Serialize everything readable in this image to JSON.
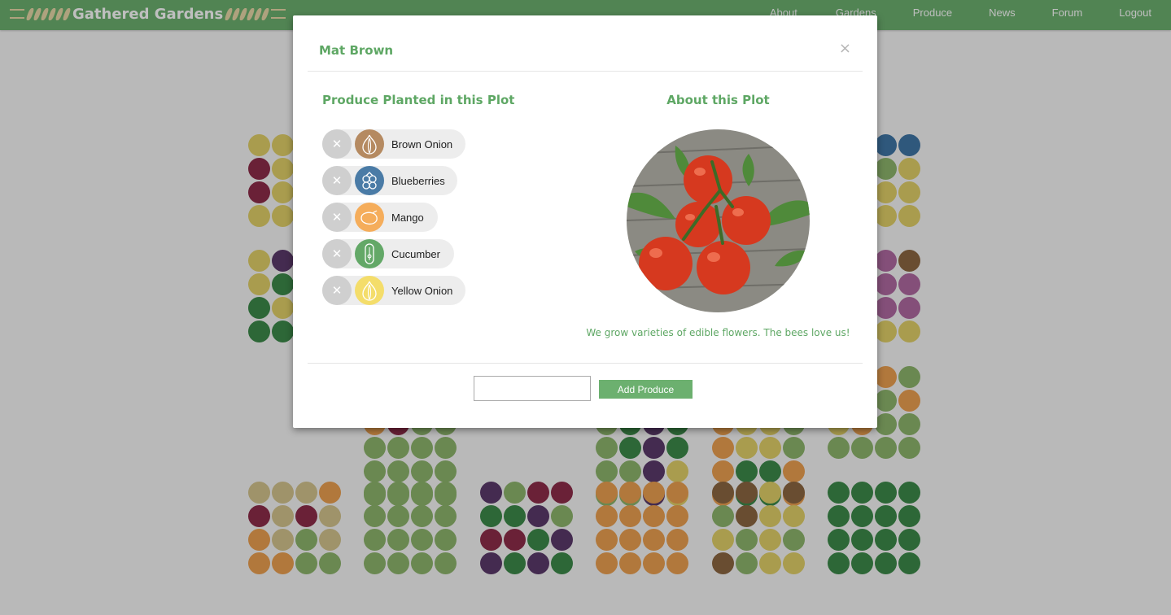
{
  "app": {
    "name": "Gathered Gardens"
  },
  "nav": {
    "about": "About",
    "gardens": "Gardens",
    "produce": "Produce",
    "news": "News",
    "forum": "Forum",
    "logout": "Logout"
  },
  "modal": {
    "title": "Mat Brown",
    "close": "×",
    "produce_heading": "Produce Planted in this Plot",
    "about_heading": "About this Plot",
    "about_text": "We grow varieties of edible flowers. The bees love us!",
    "remove_glyph": "✕",
    "produce": [
      {
        "name": "Brown Onion",
        "icon": "brown-onion-icon",
        "color": "#b58a61"
      },
      {
        "name": "Blueberries",
        "icon": "blueberries-icon",
        "color": "#4a7ba6"
      },
      {
        "name": "Mango",
        "icon": "mango-icon",
        "color": "#f5ad5b"
      },
      {
        "name": "Cucumber",
        "icon": "cucumber-icon",
        "color": "#63a867"
      },
      {
        "name": "Yellow Onion",
        "icon": "yellow-onion-icon",
        "color": "#f4dd6a"
      }
    ],
    "input_value": "",
    "add_button": "Add Produce"
  },
  "colors": {
    "brand_green": "#6cb06f",
    "yellow": "#e2d068",
    "olive": "#8eb66c",
    "dark_green": "#3c8a4a",
    "plum": "#8e2d4a",
    "purple": "#5b3a6b",
    "orange": "#eda051",
    "tan": "#d4c48e",
    "brown": "#8c6742",
    "blue": "#3f76a6",
    "pink": "#b06aa2",
    "light_green": "#9bc67e"
  }
}
